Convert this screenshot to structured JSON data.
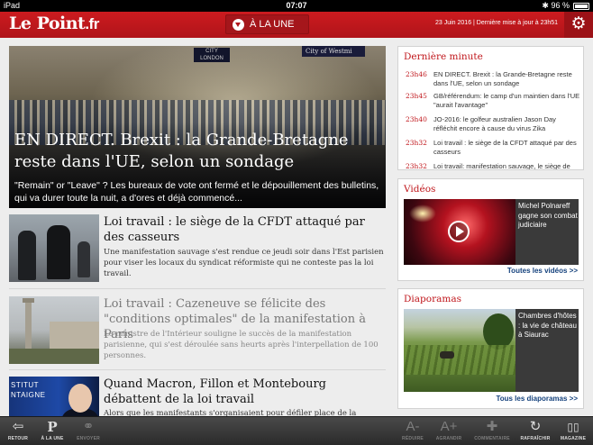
{
  "status_bar": {
    "device": "iPad",
    "time": "07:07",
    "bluetooth": "✱",
    "battery": "96 %"
  },
  "header": {
    "logo_main": "Le Point",
    "logo_tld": ".fr",
    "section_label": "À LA UNE",
    "updated": "23 Juin 2016 | Dernière mise à jour à 23h51"
  },
  "hero": {
    "image_text_left": "CITY\nLONDON",
    "image_text_right": "City of Westmi",
    "title": "EN DIRECT. Brexit : la Grande-Bretagne reste dans l'UE, selon un sondage",
    "description": "\"Remain\" or \"Leave\" ? Les bureaux de vote ont fermé et le dépouillement des bulletins, qui va durer toute la nuit, a d'ores et déjà commencé..."
  },
  "articles": [
    {
      "title": "Loi travail : le siège de la CFDT attaqué par des casseurs",
      "description": "Une manifestation sauvage s'est rendue ce jeudi soir dans l'Est parisien pour viser les locaux du syndicat réformiste qui ne conteste pas la loi travail."
    },
    {
      "title": "Loi travail : Cazeneuve se félicite des \"conditions optimales\" de la manifestation à Paris",
      "description": "Le ministre de l'Intérieur souligne le succès de la manifestation parisienne, qui s'est déroulée sans heurts après l'interpellation de 100 personnes."
    },
    {
      "title": "Quand Macron, Fillon et Montebourg débattent de la loi travail",
      "description": "Alors que les manifestants s'organisaient pour défiler place de la Bastille, les",
      "image_text": "STITUT\nNTAIGNE"
    }
  ],
  "derniere_minute": {
    "heading": "Dernière minute",
    "items": [
      {
        "time": "23h46",
        "text": "EN DIRECT. Brexit : la Grande-Bretagne reste dans l'UE, selon un sondage"
      },
      {
        "time": "23h45",
        "text": "GB/référendum: le camp d'un maintien dans l'UE \"aurait l'avantage\""
      },
      {
        "time": "23h40",
        "text": "JO-2016: le golfeur australien Jason Day réfléchit encore à cause du virus Zika"
      },
      {
        "time": "23h32",
        "text": "Loi travail : le siège de la CFDT attaqué par des casseurs"
      },
      {
        "time": "23h32",
        "text": "Loi travail: manifestation sauvage, le siège de"
      }
    ]
  },
  "videos": {
    "heading": "Vidéos",
    "caption": "Michel Polnareff gagne son combat judiciaire",
    "all_link": "Toutes les vidéos >>"
  },
  "diaporamas": {
    "heading": "Diaporamas",
    "caption": "Chambres d'hôtes : la vie de château à Siaurac",
    "all_link": "Tous les diaporamas >>"
  },
  "toolbar": {
    "items": [
      {
        "icon": "⇦",
        "label": "RETOUR"
      },
      {
        "icon": "P",
        "label": "À LA UNE"
      },
      {
        "icon": "⚭",
        "label": "ENVOYER"
      },
      {
        "icon": "A-",
        "label": "RÉDUIRE"
      },
      {
        "icon": "A+",
        "label": "AGRANDIR"
      },
      {
        "icon": "✚",
        "label": "COMMENTAIRE"
      },
      {
        "icon": "↻",
        "label": "RAFRAÎCHIR"
      },
      {
        "icon": "▯▯",
        "label": "MAGAZINE"
      }
    ]
  },
  "colors": {
    "brand_red": "#c0171c",
    "link_blue": "#15427d",
    "toolbar_bg": "#2a2a2a"
  }
}
